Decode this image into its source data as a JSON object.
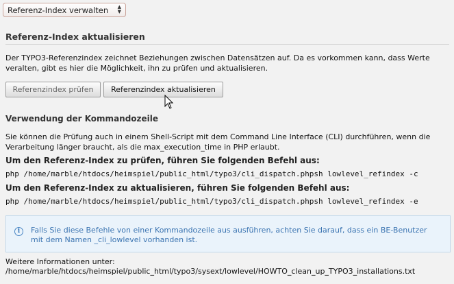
{
  "menu": {
    "selected": "Referenz-Index verwalten"
  },
  "section": {
    "title": "Referenz-Index aktualisieren",
    "description": "Der TYPO3-Referenzindex zeichnet Beziehungen zwischen Datensätzen auf. Da es vorkommen kann, dass Werte veralten, gibt es hier die Möglichkeit, ihn zu prüfen und aktualisieren.",
    "buttons": {
      "check": "Referenzindex prüfen",
      "update": "Referenzindex aktualisieren"
    }
  },
  "cli": {
    "title": "Verwendung der Kommandozeile",
    "description": "Sie können die Prüfung auch in einem Shell-Script mit dem Command Line Interface (CLI) durchführen, wenn die Verarbeitung länger braucht, als die max_execution_time in PHP erlaubt.",
    "check_heading": "Um den Referenz-Index zu prüfen, führen Sie folgenden Befehl aus:",
    "check_command": "php /home/marble/htdocs/heimspiel/public_html/typo3/cli_dispatch.phpsh lowlevel_refindex -c",
    "update_heading": "Um den Referenz-Index zu aktualisieren, führen Sie folgenden Befehl aus:",
    "update_command": "php /home/marble/htdocs/heimspiel/public_html/typo3/cli_dispatch.phpsh lowlevel_refindex -e"
  },
  "info": {
    "icon": "info-icon",
    "text": "Falls Sie diese Befehle von einer Kommandozeile aus ausführen, achten Sie darauf, dass ein BE-Benutzer mit dem Namen _cli_lowlevel vorhanden ist."
  },
  "more": {
    "label": "Weitere Informationen unter:",
    "path": "/home/marble/htdocs/heimspiel/public_html/typo3/sysext/lowlevel/HOWTO_clean_up_TYPO3_installations.txt"
  }
}
